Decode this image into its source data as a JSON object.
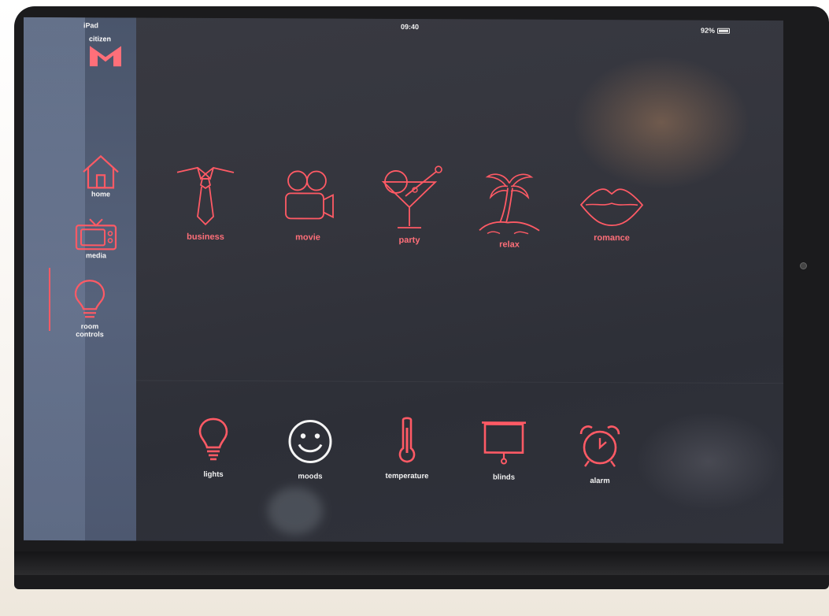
{
  "status_bar": {
    "device": "iPad",
    "time": "09:40",
    "battery": "92%"
  },
  "logo": {
    "text": "citizen",
    "letter": "M"
  },
  "sidebar": {
    "items": [
      {
        "label": "home",
        "icon": "house-icon"
      },
      {
        "label": "media",
        "icon": "tv-icon"
      },
      {
        "label": "room\ncontrols",
        "icon": "lightbulb-icon",
        "active": true
      }
    ]
  },
  "moods": [
    {
      "label": "business",
      "icon": "tie-icon"
    },
    {
      "label": "movie",
      "icon": "film-camera-icon"
    },
    {
      "label": "party",
      "icon": "cocktail-icon"
    },
    {
      "label": "relax",
      "icon": "palm-tree-icon"
    },
    {
      "label": "romance",
      "icon": "lips-icon"
    }
  ],
  "controls": [
    {
      "label": "lights",
      "icon": "lightbulb-icon"
    },
    {
      "label": "moods",
      "icon": "smiley-icon"
    },
    {
      "label": "temperature",
      "icon": "thermometer-icon"
    },
    {
      "label": "blinds",
      "icon": "projector-screen-icon"
    },
    {
      "label": "alarm",
      "icon": "alarm-clock-icon"
    }
  ],
  "colors": {
    "accent": "#ff5a65",
    "sidebar": "#56627b",
    "screen": "#2d2f37"
  }
}
